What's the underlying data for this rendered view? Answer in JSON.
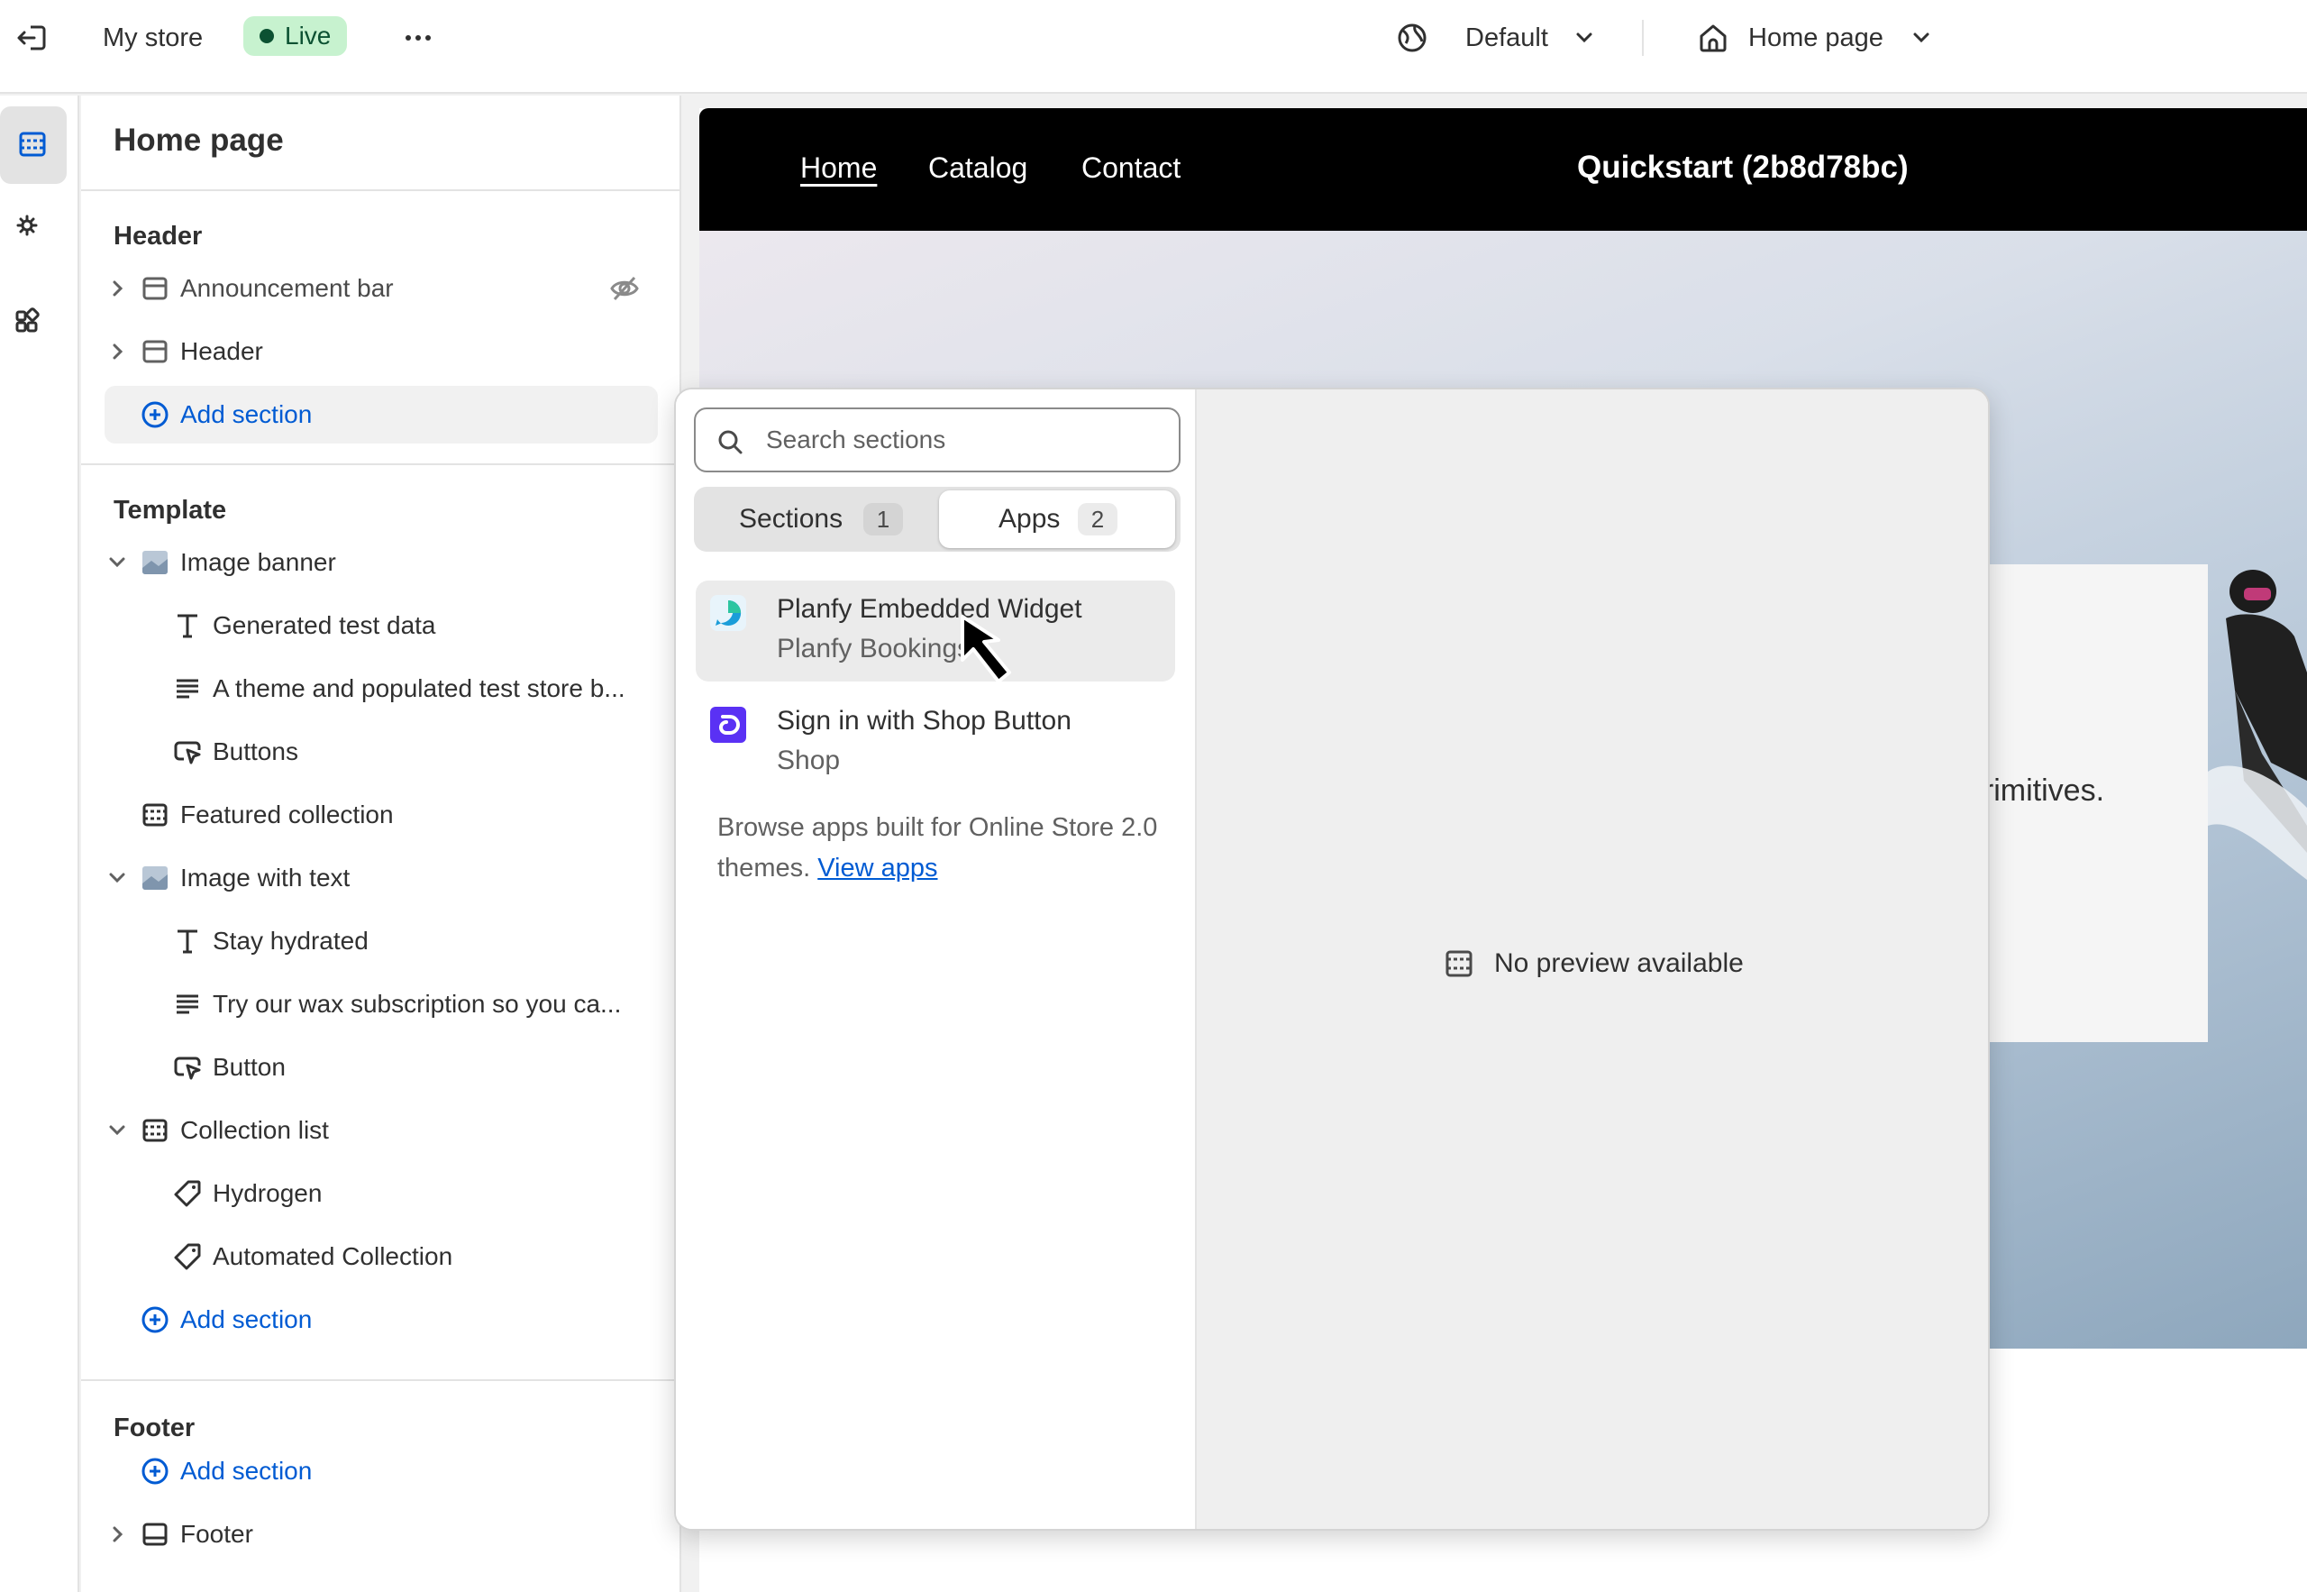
{
  "topbar": {
    "exit_icon": "exit-icon",
    "store_name": "My store",
    "status": "Live",
    "more_icon": "ellipsis-icon",
    "theme_label": "Default",
    "page_label": "Home page"
  },
  "rail": {
    "items": [
      {
        "icon": "sections-icon",
        "active": true
      },
      {
        "icon": "gear-icon"
      },
      {
        "icon": "apps-icon"
      }
    ]
  },
  "sidebar": {
    "title": "Home page",
    "header_group": {
      "title": "Header",
      "items": [
        {
          "label": "Announcement bar",
          "hidden": true
        },
        {
          "label": "Header"
        }
      ],
      "add_section": "Add section"
    },
    "template_group": {
      "title": "Template",
      "items": [
        {
          "label": "Image banner"
        },
        {
          "label": "Generated test data"
        },
        {
          "label": "A theme and populated test store b..."
        },
        {
          "label": "Buttons"
        },
        {
          "label": "Featured collection"
        },
        {
          "label": "Image with text"
        },
        {
          "label": "Stay hydrated"
        },
        {
          "label": "Try our wax subscription so you ca..."
        },
        {
          "label": "Button"
        },
        {
          "label": "Collection list"
        },
        {
          "label": "Hydrogen"
        },
        {
          "label": "Automated Collection"
        }
      ],
      "add_section": "Add section"
    },
    "footer_group": {
      "title": "Footer",
      "add_section": "Add section",
      "items": [
        {
          "label": "Footer"
        }
      ]
    }
  },
  "preview": {
    "nav_links": [
      "Home",
      "Catalog",
      "Contact"
    ],
    "brand": "Quickstart (2b8d78bc)",
    "card_text": "primitives."
  },
  "picker": {
    "search_placeholder": "Search sections",
    "tabs": [
      {
        "label": "Sections",
        "count": "1"
      },
      {
        "label": "Apps",
        "count": "2",
        "active": true
      }
    ],
    "apps": [
      {
        "name": "Planfy Embedded Widget",
        "developer": "Planfy Bookings",
        "logo_color": "#1a9dd9"
      },
      {
        "name": "Sign in with Shop Button",
        "developer": "Shop",
        "logo_color": "#5a31f4"
      }
    ],
    "browse_text": "Browse apps built for Online Store 2.0 themes.",
    "browse_link": "View apps",
    "no_preview": "No preview available"
  }
}
